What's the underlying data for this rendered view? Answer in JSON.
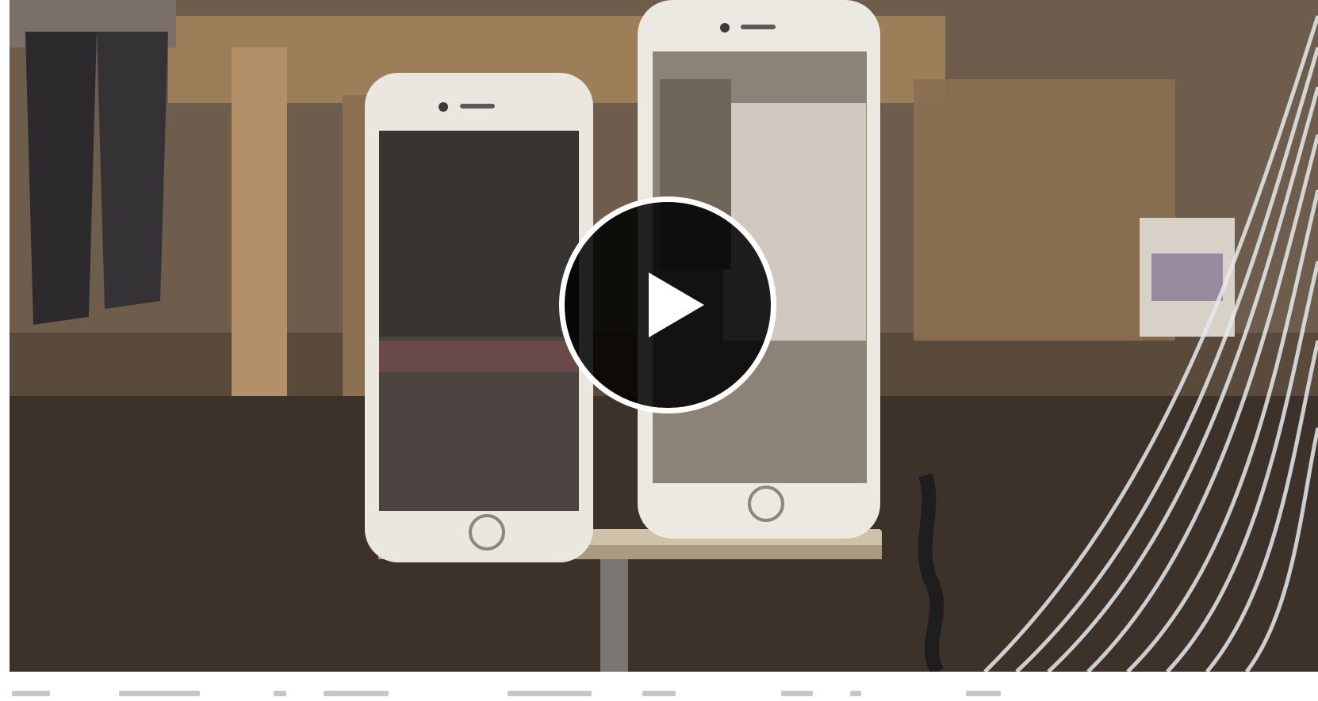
{
  "video": {
    "state": "paused",
    "play_button_icon": "play-icon",
    "colors": {
      "overlay": "#000000",
      "ring": "#ffffff"
    }
  }
}
